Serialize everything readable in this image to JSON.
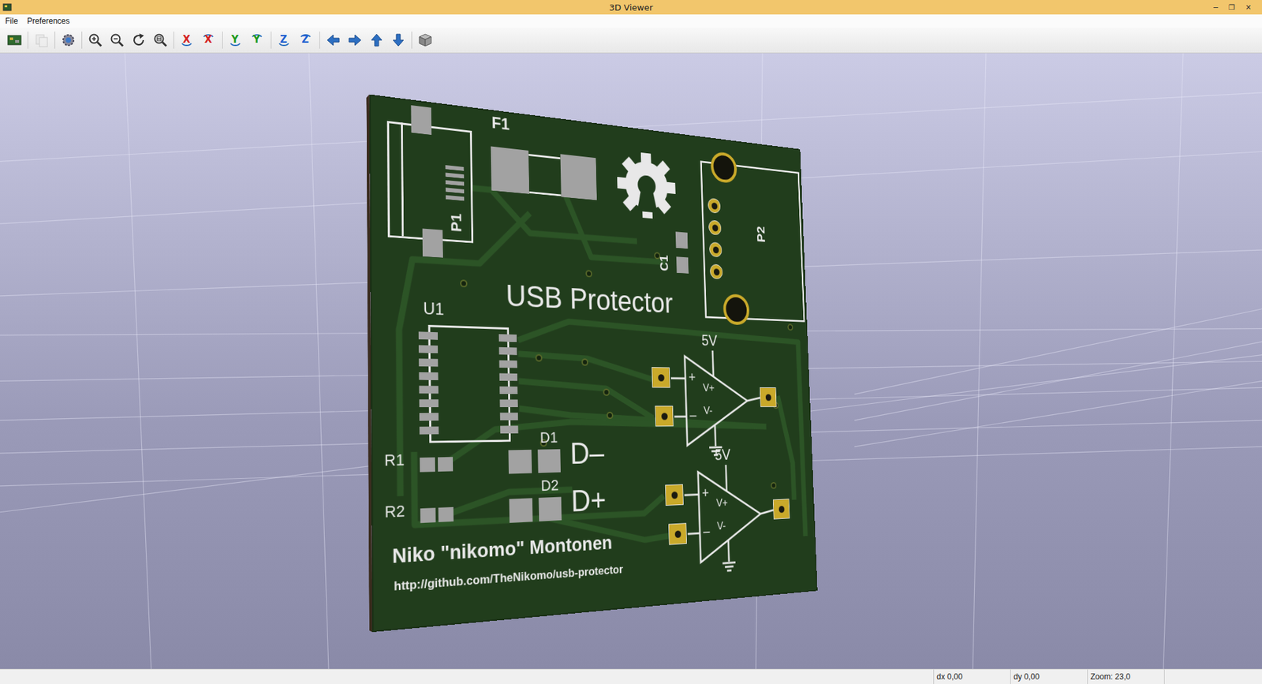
{
  "window": {
    "title": "3D Viewer",
    "controls": [
      "─",
      "❐",
      "✕"
    ]
  },
  "menu": [
    "File",
    "Preferences"
  ],
  "toolbar": [
    [
      {
        "kind": "reload",
        "disabled": false
      }
    ],
    [
      {
        "kind": "copy",
        "disabled": true
      }
    ],
    [
      {
        "kind": "settings",
        "disabled": false
      }
    ],
    [
      {
        "kind": "zoom-in",
        "disabled": false
      },
      {
        "kind": "zoom-out",
        "disabled": false
      },
      {
        "kind": "redraw",
        "disabled": false
      },
      {
        "kind": "zoom-fit",
        "disabled": false
      }
    ],
    [
      {
        "kind": "rotate-x",
        "text": "X",
        "disabled": false
      },
      {
        "kind": "rotate-x-back",
        "text": "X",
        "disabled": false
      }
    ],
    [
      {
        "kind": "rotate-y",
        "text": "Y",
        "disabled": false
      },
      {
        "kind": "rotate-y-back",
        "text": "Y",
        "disabled": false
      }
    ],
    [
      {
        "kind": "rotate-z",
        "text": "Z",
        "disabled": false
      },
      {
        "kind": "rotate-z-back",
        "text": "Z",
        "disabled": false
      }
    ],
    [
      {
        "kind": "move-left",
        "disabled": false
      },
      {
        "kind": "move-right",
        "disabled": false
      },
      {
        "kind": "move-up",
        "disabled": false
      },
      {
        "kind": "move-down",
        "disabled": false
      }
    ],
    [
      {
        "kind": "ortho",
        "disabled": false
      }
    ]
  ],
  "board": {
    "title": "USB Protector",
    "fuse": "F1",
    "usb_connector": "P1",
    "header": "P2",
    "capacitor": "C1",
    "ic": "U1",
    "rows": [
      {
        "resistor": "R1",
        "diode": "D1",
        "signal": "D–"
      },
      {
        "resistor": "R2",
        "diode": "D2",
        "signal": "D+"
      }
    ],
    "opamps": [
      {
        "supply": "5V",
        "plus": "+",
        "minus": "–",
        "vplus": "V+",
        "vminus": "V-"
      },
      {
        "supply": "5V",
        "plus": "+",
        "minus": "–",
        "vplus": "V+",
        "vminus": "V-"
      }
    ],
    "author": "Niko \"nikomo\" Montonen",
    "url": "http://github.com/TheNikomo/usb-protector"
  },
  "status_bar": [
    "dx 0,00",
    "dy 0,00",
    "Zoom: 23,0"
  ]
}
